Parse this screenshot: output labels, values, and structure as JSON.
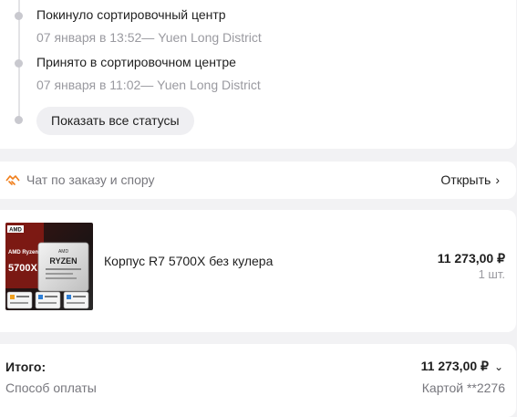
{
  "timeline": {
    "events": [
      {
        "title": "Покинуло сортировочный центр",
        "subtitle": "07 января в 13:52— Yuen Long District"
      },
      {
        "title": "Принято в сортировочном центре",
        "subtitle": "07 января в 11:02— Yuen Long District"
      }
    ],
    "show_all_button": "Показать все статусы"
  },
  "chat": {
    "icon": "chat-handshake-icon",
    "label": "Чат по заказу и спору",
    "open_label": "Открыть",
    "open_icon": "chevron-right-icon",
    "accent_color": "#f07e1a"
  },
  "product": {
    "name": "Корпус R7 5700X без кулера",
    "price": "11 273,00 ₽",
    "quantity": "1 шт.",
    "image": {
      "box_badge": "AMD",
      "box_brand": "AMD Ryzen 7",
      "box_model": "5700X",
      "chip_text": "RYZEN",
      "chip_sub": "AMD"
    }
  },
  "totals": {
    "label": "Итого:",
    "value": "11 273,00 ₽",
    "payment_label": "Способ оплаты",
    "payment_value": "Картой **2276"
  }
}
